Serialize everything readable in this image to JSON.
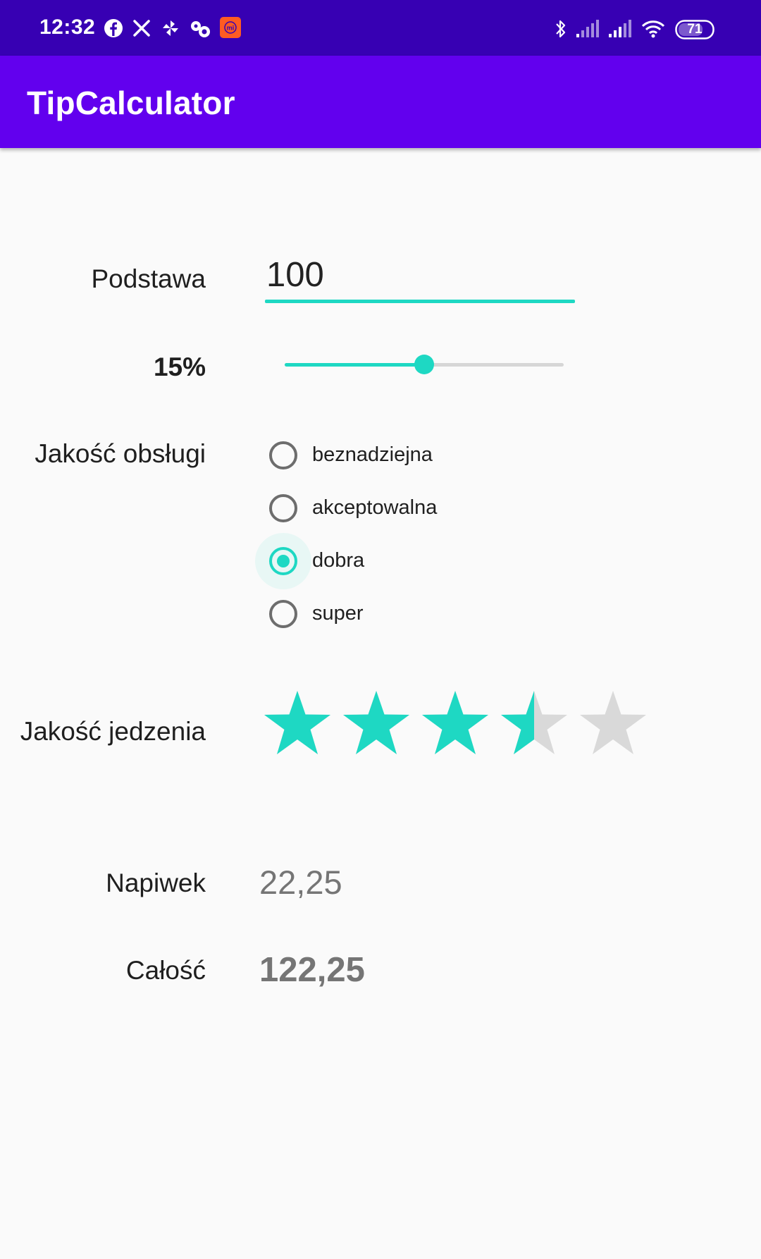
{
  "status_bar": {
    "time": "12:32",
    "left_icons": [
      "facebook-icon",
      "x-icon",
      "pinwheel-icon",
      "flower-icon",
      "mi-icon"
    ],
    "right_icons": [
      "bluetooth-icon",
      "signal-icon",
      "signal-icon",
      "wifi-icon",
      "battery-icon"
    ],
    "battery": "71",
    "colors": {
      "background": "#3700b3",
      "mi_badge": "#ff5b22"
    }
  },
  "app_bar": {
    "title": "TipCalculator",
    "color": "#6200ee"
  },
  "form": {
    "base": {
      "label": "Podstawa",
      "value": "100"
    },
    "tip_percent": {
      "label": "15%",
      "value": 0.5
    },
    "service": {
      "label": "Jakość obsługi",
      "options": [
        "beznadziejna",
        "akceptowalna",
        "dobra",
        "super"
      ],
      "selected": "dobra"
    },
    "food": {
      "label": "Jakość jedzenia",
      "rating": 3.5,
      "max": 5
    }
  },
  "results": {
    "tip": {
      "label": "Napiwek",
      "value": "22,25"
    },
    "total": {
      "label": "Całość",
      "value": "122,25"
    }
  },
  "colors": {
    "accent": "#1ed8c3",
    "inactive": "#d9d9d9"
  }
}
